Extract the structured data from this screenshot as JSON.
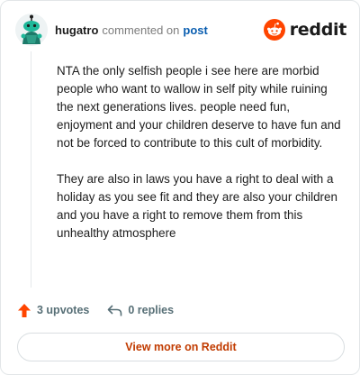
{
  "header": {
    "username": "hugatro",
    "verb": "commented on",
    "post_link": "post",
    "brand": "reddit",
    "brand_color": "#ff4500"
  },
  "comment": {
    "paragraphs": [
      "NTA the only selfish people i see here are morbid people who want to wallow in self pity while ruining the next generations lives. people need fun, enjoyment and your children deserve to have fun and not be forced to contribute to this cult of morbidity.",
      "They are also in laws you have a right to deal with a holiday as you see fit and they are also your children and you have a right to remove them from this unhealthy atmosphere"
    ]
  },
  "actions": {
    "upvotes_label": "3 upvotes",
    "replies_label": "0 replies",
    "upvote_icon": "upvote-arrow-icon",
    "reply_icon": "reply-arrow-icon"
  },
  "footer": {
    "view_more_label": "View more on Reddit",
    "accent_color": "#c13b00"
  }
}
